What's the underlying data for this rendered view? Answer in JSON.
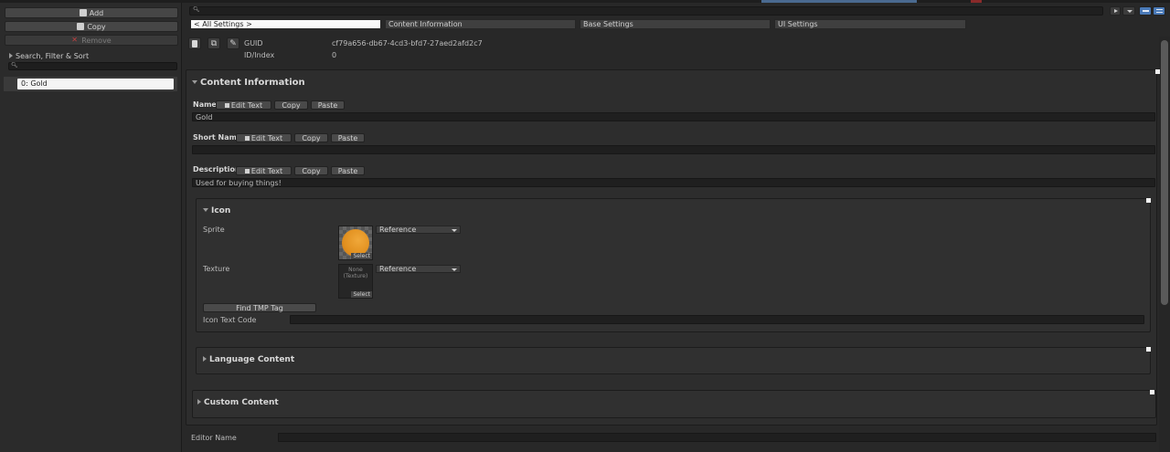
{
  "left": {
    "add_label": "Add",
    "copy_label": "Copy",
    "remove_label": "Remove",
    "foldout_label": "Search, Filter & Sort",
    "selected_item": "0: Gold"
  },
  "nav": {
    "all_settings": "< All Settings >",
    "content_info": "Content Information",
    "base_settings": "Base Settings",
    "ui_settings": "UI Settings"
  },
  "guid": {
    "guid_label": "GUID",
    "guid_value": "cf79a656-db67-4cd3-bfd7-27aed2afd2c7",
    "id_label": "ID/Index",
    "id_value": "0"
  },
  "content": {
    "header": "Content Information",
    "name_label": "Name",
    "name_value": "Gold",
    "short_name_label": "Short Name",
    "short_name_value": "",
    "description_label": "Description",
    "description_value": "Used for buying things!",
    "edit_text": "Edit Text",
    "copy": "Copy",
    "paste": "Paste"
  },
  "icon": {
    "header": "Icon",
    "sprite_label": "Sprite",
    "texture_label": "Texture",
    "sprite_mode": "Reference",
    "texture_mode": "Reference",
    "texture_none": "None",
    "texture_type": "(Texture)",
    "select": "Select",
    "find_tmp": "Find TMP Tag",
    "icon_text_code_label": "Icon Text Code"
  },
  "language": {
    "header": "Language Content"
  },
  "custom": {
    "header": "Custom Content"
  },
  "editor": {
    "label": "Editor Name"
  },
  "colors": {
    "accent": "#4a7ab8",
    "coin": "#e1901f",
    "background": "#282828"
  }
}
